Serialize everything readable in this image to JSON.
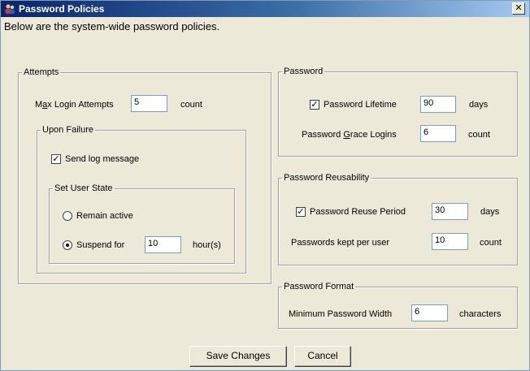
{
  "window": {
    "title": "Password Policies",
    "close_glyph": "✕",
    "description": "Below are the system-wide password policies."
  },
  "attempts": {
    "legend": "Attempts",
    "max_login": {
      "label_pre": "M",
      "label_accel": "a",
      "label_post": "x Login Attempts",
      "value": "5",
      "unit": "count"
    },
    "upon_failure": {
      "legend": "Upon Failure",
      "send_log": {
        "label": "Send log message",
        "checked": true,
        "check_glyph": "✓"
      },
      "set_user_state": {
        "legend": "Set User State",
        "remain_active": {
          "label": "Remain active",
          "selected": false
        },
        "suspend_for": {
          "label": "Suspend for",
          "selected": true,
          "value": "10",
          "unit": "hour(s)"
        }
      }
    }
  },
  "password": {
    "legend": "Password",
    "lifetime": {
      "label": "Password Lifetime",
      "checked": true,
      "check_glyph": "✓",
      "value": "90",
      "unit": "days"
    },
    "grace_logins": {
      "label_pre": "Password ",
      "label_accel": "G",
      "label_post": "race Logins",
      "value": "6",
      "unit": "count"
    }
  },
  "reusability": {
    "legend": "Password Reusability",
    "reuse_period": {
      "label": "Password Reuse Period",
      "checked": true,
      "check_glyph": "✓",
      "value": "30",
      "unit": "days"
    },
    "kept_per_user": {
      "label": "Passwords kept per user",
      "value": "10",
      "unit": "count"
    }
  },
  "format": {
    "legend": "Password Format",
    "min_width": {
      "label": "Minimum Password Width",
      "value": "6",
      "unit": "characters"
    }
  },
  "buttons": {
    "save": "Save Changes",
    "cancel": "Cancel"
  }
}
